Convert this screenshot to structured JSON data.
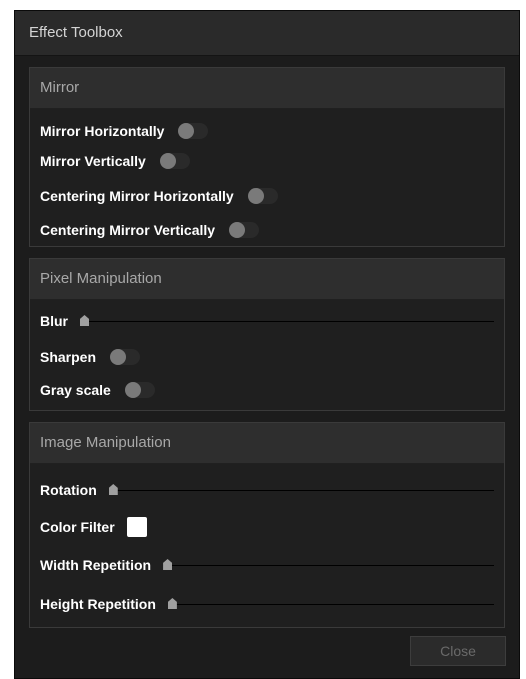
{
  "window": {
    "title": "Effect Toolbox"
  },
  "mirror": {
    "title": "Mirror",
    "items": [
      {
        "label": "Mirror Horizontally",
        "on": false
      },
      {
        "label": "Mirror Vertically",
        "on": false
      },
      {
        "label": "Centering Mirror Horizontally",
        "on": false
      },
      {
        "label": "Centering Mirror Vertically",
        "on": false
      }
    ]
  },
  "pixel": {
    "title": "Pixel Manipulation",
    "blur_label": "Blur",
    "blur_value": 0,
    "sharpen_label": "Sharpen",
    "sharpen_on": false,
    "grayscale_label": "Gray scale",
    "grayscale_on": false
  },
  "image": {
    "title": "Image Manipulation",
    "rotation_label": "Rotation",
    "rotation_value": 0,
    "color_filter_label": "Color Filter",
    "color_filter_color": "#ffffff",
    "width_repetition_label": "Width Repetition",
    "width_repetition_value": 0,
    "height_repetition_label": "Height Repetition",
    "height_repetition_value": 0
  },
  "footer": {
    "close_label": "Close"
  }
}
